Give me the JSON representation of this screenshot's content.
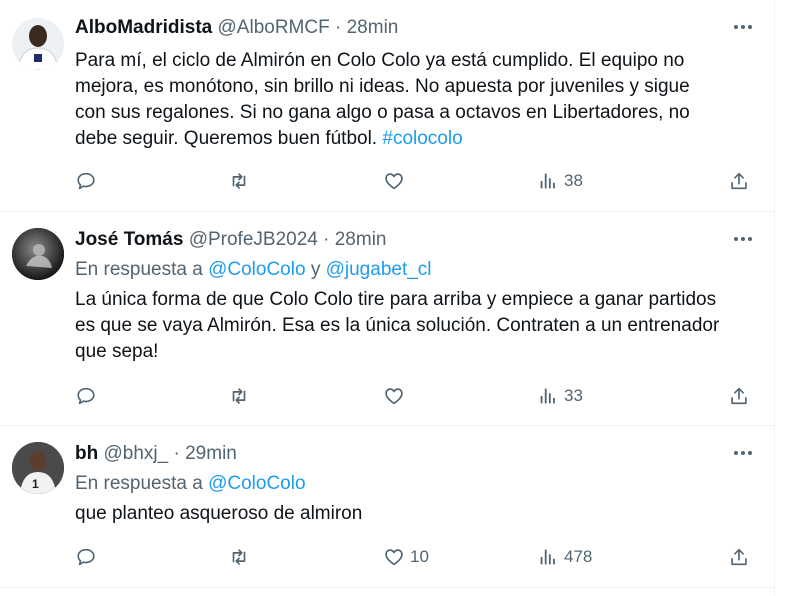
{
  "tweets": [
    {
      "name": "AlboMadridista",
      "handle": "@AlboRMCF",
      "separator": "·",
      "time": "28min",
      "reply_label": "",
      "reply_mentions": [],
      "text": "Para mí, el ciclo de Almirón en Colo Colo ya está cumplido. El equipo no\nmejora, es monótono, sin brillo ni ideas. No apuesta por juveniles y sigue\ncon sus regalones. Si no gana algo o pasa a octavos en Libertadores, no\ndebe seguir. Queremos buen fútbol. ",
      "hashtag": "#colocolo",
      "likes": "",
      "views": "38"
    },
    {
      "name": "José Tomás",
      "handle": "@ProfeJB2024",
      "separator": "·",
      "time": "28min",
      "reply_label": "En respuesta a",
      "reply_mentions": [
        "@ColoColo",
        "y",
        "@jugabet_cl"
      ],
      "text": "La única forma de que Colo Colo tire para arriba y empiece a ganar partidos\nes que se vaya Almirón. Esa es la única solución. Contraten a un entrenador\nque sepa!",
      "hashtag": "",
      "likes": "",
      "views": "33"
    },
    {
      "name": "bh",
      "handle": "@bhxj_",
      "separator": "·",
      "time": "29min",
      "reply_label": "En respuesta a",
      "reply_mentions": [
        "@ColoColo"
      ],
      "text": "que planteo asqueroso de almiron",
      "hashtag": "",
      "likes": "10",
      "views": "478"
    }
  ],
  "icons": {
    "reply": "reply-icon",
    "retweet": "retweet-icon",
    "like": "heart-icon",
    "views": "views-icon",
    "share": "share-icon",
    "more": "more-icon"
  },
  "colors": {
    "link": "#1d9bf0",
    "secondary": "#536471",
    "text": "#0f1419",
    "divider": "#eff3f4"
  }
}
